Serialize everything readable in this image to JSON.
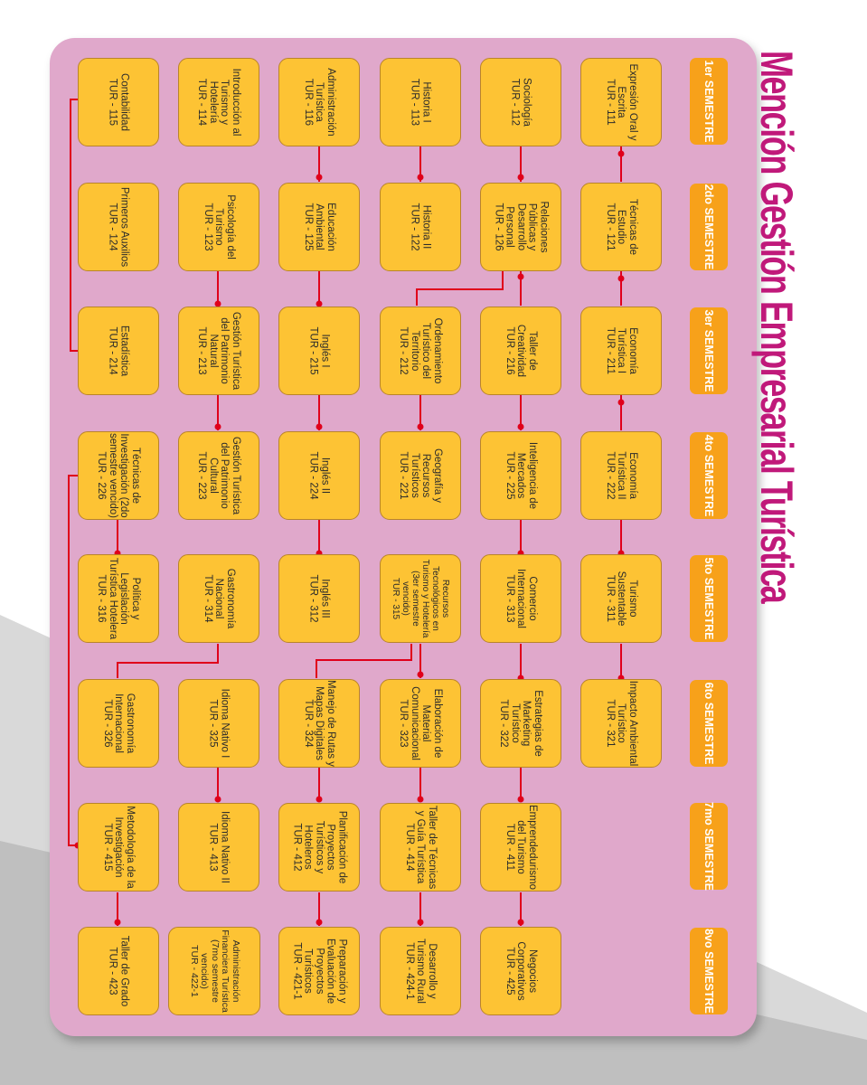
{
  "title": "Mención Gestión Empresarial Turística",
  "colors": {
    "board": "#e0a8cb",
    "semester": "#f7a11a",
    "course": "#fdc334",
    "title": "#c0197a",
    "link": "#e0001b"
  },
  "semesters": [
    "1er SEMESTRE",
    "2do SEMESTRE",
    "3er SEMESTRE",
    "4to SEMESTRE",
    "5to SEMESTRE",
    "6to SEMESTRE",
    "7mo SEMESTRE",
    "8vo SEMESTRE"
  ],
  "courses": {
    "r0": [
      {
        "name": "Expresión Oral y Escrita",
        "code": "TUR - 111"
      },
      {
        "name": "Técnicas de Estudio",
        "code": "TUR - 121"
      },
      {
        "name": "Economía Turística I",
        "code": "TUR - 211"
      },
      {
        "name": "Economía Turística II",
        "code": "TUR - 222"
      },
      {
        "name": "Turismo Sustentable",
        "code": "TUR - 311"
      },
      {
        "name": "Impacto Ambiental Turístico",
        "code": "TUR - 321"
      }
    ],
    "r1": [
      {
        "name": "Sociología",
        "code": "TUR - 112"
      },
      {
        "name": "Relaciones Públicas y Desarrollo Personal",
        "code": "TUR - 126"
      },
      {
        "name": "Taller de Creatividad",
        "code": "TUR - 216"
      },
      {
        "name": "Inteligencia de Mercados",
        "code": "TUR - 225"
      },
      {
        "name": "Comercio Internacional",
        "code": "TUR - 313"
      },
      {
        "name": "Estrategias de Marketing Turístico",
        "code": "TUR - 322"
      },
      {
        "name": "Emprendedurismo del Turismo",
        "code": "TUR - 411"
      },
      {
        "name": "Negocios Corporativos",
        "code": "TUR - 425"
      }
    ],
    "r2": [
      {
        "name": "Historia I",
        "code": "TUR - 113"
      },
      {
        "name": "Historia II",
        "code": "TUR - 122"
      },
      {
        "name": "Ordenamiento Turístico del Territorio",
        "code": "TUR - 212"
      },
      {
        "name": "Geografía y Recursos Turísticos",
        "code": "TUR - 221"
      },
      {
        "name": "Recursos Tecnológicos en Turismo y Hotelería (3er semestre vencido)",
        "code": "TUR - 315"
      },
      {
        "name": "Elaboración de Material Comunicacional",
        "code": "TUR - 323"
      },
      {
        "name": "Taller de Técnicas y Guía Turística",
        "code": "TUR - 414"
      },
      {
        "name": "Desarrollo y Turismo Rural",
        "code": "TUR - 424-1"
      }
    ],
    "r3": [
      {
        "name": "Administración Turística",
        "code": "TUR - 116"
      },
      {
        "name": "Educación Ambiental",
        "code": "TUR - 125"
      },
      {
        "name": "Inglés I",
        "code": "TUR - 215"
      },
      {
        "name": "Inglés II",
        "code": "TUR - 224"
      },
      {
        "name": "Inglés III",
        "code": "TUR - 312"
      },
      {
        "name": "Manejo de Rutas y Mapas Digitales",
        "code": "TUR - 324"
      },
      {
        "name": "Planificación de Proyectos Turísticos y Hoteleros",
        "code": "TUR - 412"
      },
      {
        "name": "Preparación y Evaluación de Proyectos Turísticos",
        "code": "TUR - 421-1"
      }
    ],
    "r4": [
      {
        "name": "Introducción al Turismo y Hotelería",
        "code": "TUR - 114"
      },
      {
        "name": "Psicología del Turismo",
        "code": "TUR - 123"
      },
      {
        "name": "Gestión Turística del Patrimonio Natural",
        "code": "TUR - 213"
      },
      {
        "name": "Gestión Turística del Patrimonio Cultural",
        "code": "TUR - 223"
      },
      {
        "name": "Gastronomía Nacional",
        "code": "TUR - 314"
      },
      {
        "name": "Idioma Nativo I",
        "code": "TUR - 325"
      },
      {
        "name": "Idioma Nativo II",
        "code": "TUR - 413"
      },
      {
        "name": "Administración Financiera Turística (7mo semestre vencido)",
        "code": "TUR - 422-1"
      }
    ],
    "r5": [
      {
        "name": "Contabilidad",
        "code": "TUR - 115"
      },
      {
        "name": "Primeros Auxilios",
        "code": "TUR - 124"
      },
      {
        "name": "Estadística",
        "code": "TUR - 214"
      },
      {
        "name": "Técnicas de Investigación (2do semestre vencido)",
        "code": "TUR - 226"
      },
      {
        "name": "Política y Legislación Turística Hotelera",
        "code": "TUR - 316"
      },
      {
        "name": "Gastronomía Internacional",
        "code": "TUR - 326"
      },
      {
        "name": "Metodología de la Investigación",
        "code": "TUR - 415"
      },
      {
        "name": "Taller de Grado",
        "code": "TUR - 423"
      }
    ]
  }
}
